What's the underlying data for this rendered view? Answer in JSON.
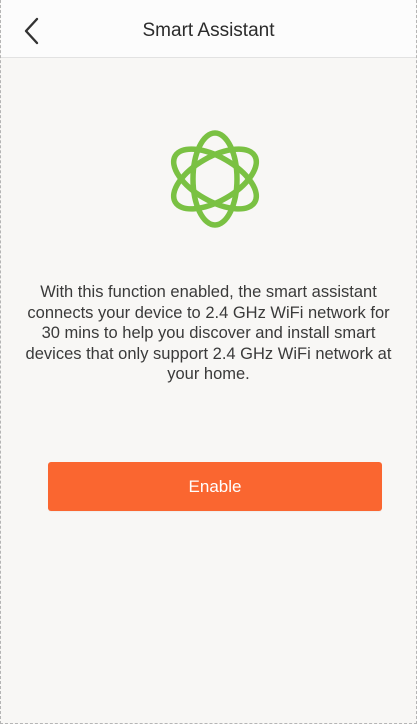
{
  "header": {
    "back_icon": "chevron-left-icon",
    "title": "Smart Assistant"
  },
  "main": {
    "logo_icon": "atom-orbit-icon",
    "description": "With this function enabled, the smart assistant connects your device to 2.4 GHz WiFi network for 30 mins to help you discover and install smart devices that only support 2.4 GHz WiFi network at your home.",
    "enable_button_label": "Enable"
  },
  "colors": {
    "accent": "#fa6630",
    "logo_green": "#7ac143",
    "background": "#f8f7f5"
  }
}
